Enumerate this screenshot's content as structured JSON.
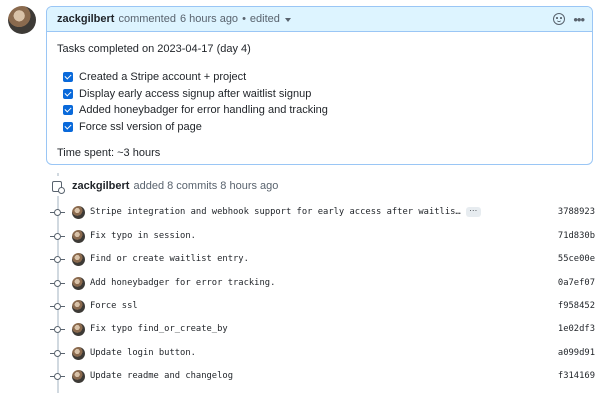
{
  "comment": {
    "author": "zackgilbert",
    "action": "commented",
    "time": "6 hours ago",
    "separator": "•",
    "edited": "edited",
    "title": "Tasks completed on 2023-04-17 (day 4)",
    "tasks": [
      {
        "label": "Created a Stripe account + project",
        "checked": true
      },
      {
        "label": "Display early access signup after waitlist signup",
        "checked": true
      },
      {
        "label": "Added honeybadger for error handling and tracking",
        "checked": true
      },
      {
        "label": "Force ssl version of page",
        "checked": true
      }
    ],
    "time_spent": "Time spent: ~3 hours",
    "icons": {
      "reaction": "smiley-icon",
      "menu": "kebab-icon"
    },
    "colors": {
      "header_bg": "#ddf4ff",
      "border": "#9ac6f5",
      "checkbox": "#0969da"
    }
  },
  "event": {
    "author": "zackgilbert",
    "text": "added 8 commits 8 hours ago",
    "icon": "commit-push-icon"
  },
  "commits": [
    {
      "message": "Stripe integration and webhook support for early access after waitlis…",
      "sha": "3788923",
      "has_more": true,
      "more_label": "···"
    },
    {
      "message": "Fix typo in session.",
      "sha": "71d830b"
    },
    {
      "message": "Find or create waitlist entry.",
      "sha": "55ce00e"
    },
    {
      "message": "Add honeybadger for error tracking.",
      "sha": "0a7ef07"
    },
    {
      "message": "Force ssl",
      "sha": "f958452"
    },
    {
      "message": "Fix typo find_or_create_by",
      "sha": "1e02df3"
    },
    {
      "message": "Update login button.",
      "sha": "a099d91"
    },
    {
      "message": "Update readme and changelog",
      "sha": "f314169"
    }
  ]
}
